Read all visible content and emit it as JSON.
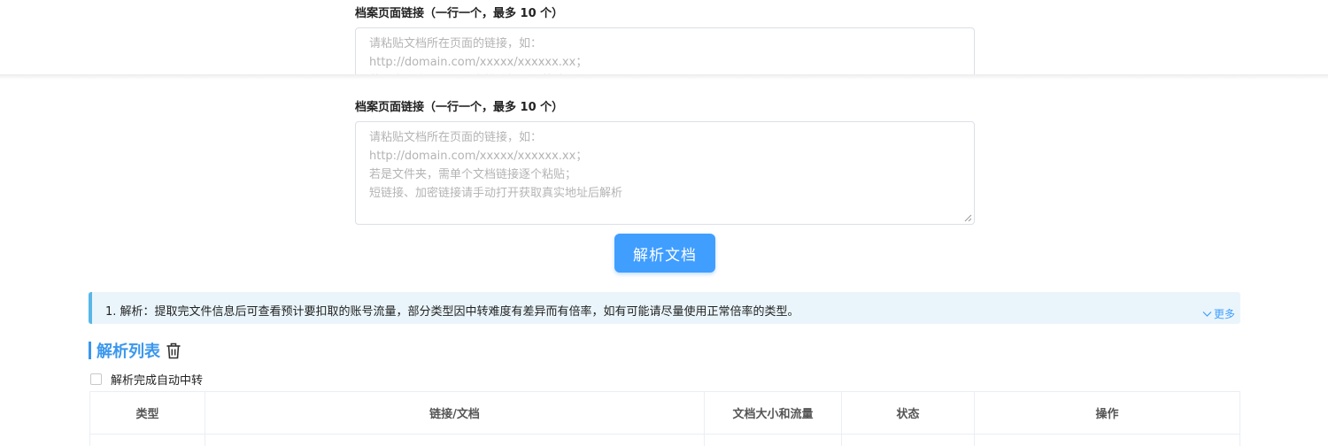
{
  "form": {
    "label": "档案页面链接（一行一个，最多 10 个）",
    "placeholder_lines": [
      "请粘贴文档所在页面的链接，如：",
      "http://domain.com/xxxxx/xxxxxx.xx；",
      "若是文件夹，需单个文档链接逐个粘贴；",
      "短链接、加密链接请手动打开获取真实地址后解析"
    ],
    "parse_button": "解析文档"
  },
  "notice": {
    "text": "1. 解析：提取完文件信息后可查看预计要扣取的账号流量，部分类型因中转难度有差异而有倍率，如有可能请尽量使用正常倍率的类型。",
    "more": "更多"
  },
  "list": {
    "title": "解析列表",
    "auto_transfer_label": "解析完成自动中转",
    "columns": [
      "类型",
      "链接/文档",
      "文档大小和流量",
      "状态",
      "操作"
    ]
  },
  "colors": {
    "primary": "#409eff",
    "title_blue": "#3a97ee",
    "notice_bg": "#eaf5fb",
    "notice_border": "#58b7e6"
  }
}
